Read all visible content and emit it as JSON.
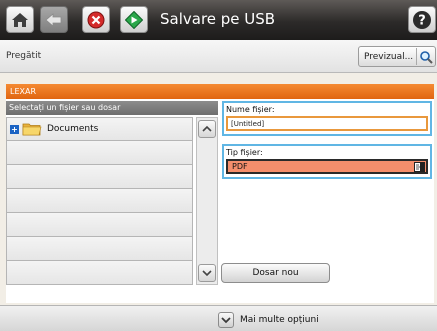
{
  "header": {
    "title": "Salvare pe USB"
  },
  "status": {
    "text": "Pregătit",
    "preview_label": "Previzual..."
  },
  "device": {
    "name": "LEXAR"
  },
  "file_list": {
    "header": "Selectați un fișier sau dosar",
    "items": [
      {
        "label": "Documents",
        "type": "folder"
      }
    ]
  },
  "file_name": {
    "label": "Nume fișier:",
    "value": "[Untitled]"
  },
  "file_type": {
    "label": "Tip fișier:",
    "value": "PDF"
  },
  "new_folder_label": "Dosar nou",
  "more_options_label": "Mai multe opțiuni",
  "colors": {
    "accent_orange": "#e87725",
    "focus_blue": "#60b6e4",
    "selection_salmon": "#f48e6c",
    "title_bar": "#2c2a29"
  },
  "icons": [
    "home-icon",
    "back-icon",
    "stop-icon",
    "start-icon",
    "help-icon",
    "search-icon",
    "folder-icon",
    "expand-icon",
    "scroll-up-icon",
    "scroll-down-icon",
    "document-icon",
    "chevron-down-icon"
  ]
}
